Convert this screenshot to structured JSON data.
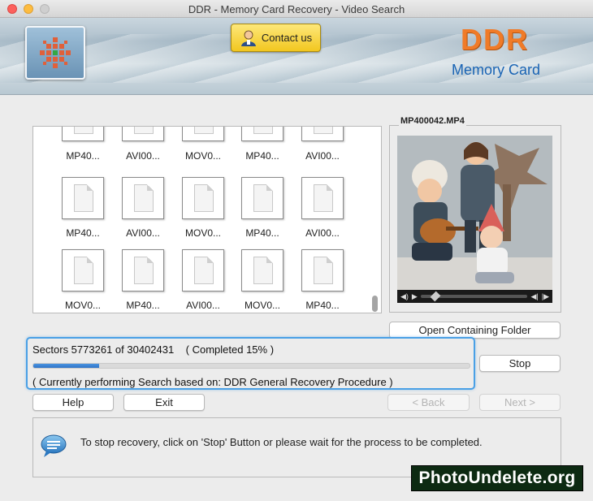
{
  "window": {
    "title": "DDR - Memory Card Recovery - Video Search"
  },
  "header": {
    "contact_label": "Contact us",
    "brand_title": "DDR",
    "brand_subtitle": "Memory Card"
  },
  "files": {
    "rows": [
      [
        "MP40...",
        "AVI00...",
        "MOV0...",
        "MP40...",
        "AVI00..."
      ],
      [
        "MP40...",
        "AVI00...",
        "MOV0...",
        "MP40...",
        "AVI00..."
      ],
      [
        "MOV0...",
        "MP40...",
        "AVI00...",
        "MOV0...",
        "MP40..."
      ]
    ]
  },
  "preview": {
    "filename": "MP400042.MP4"
  },
  "buttons": {
    "open_folder": "Open Containing Folder",
    "stop": "Stop",
    "help": "Help",
    "exit": "Exit",
    "back": "< Back",
    "next": "Next >"
  },
  "progress": {
    "sectors_text": "Sectors 5773261 of 30402431    ( Completed 15% )",
    "percent": 15,
    "procedure_text": "( Currently performing Search based on: DDR General Recovery Procedure )"
  },
  "info": {
    "message": "To stop recovery, click on 'Stop' Button or please wait for the process to be completed."
  },
  "watermark": "PhotoUndelete.org",
  "colors": {
    "accent": "#4aa0e6",
    "brand_orange": "#f07b28",
    "brand_blue": "#1a64b4"
  }
}
